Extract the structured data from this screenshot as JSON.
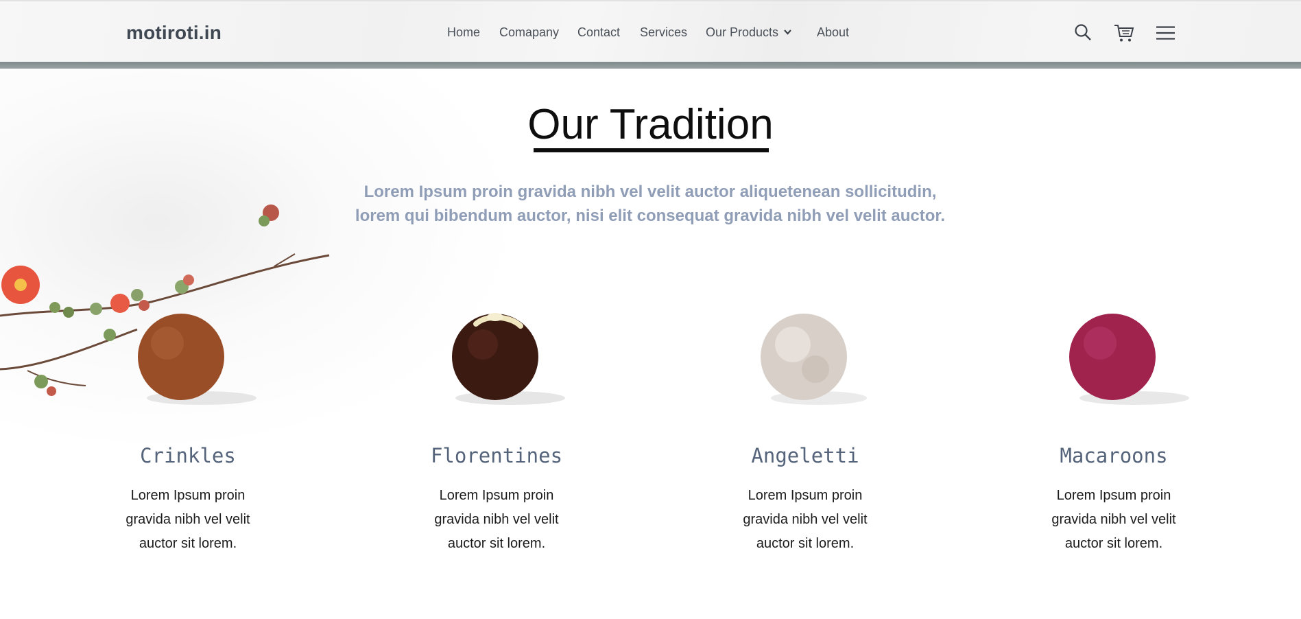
{
  "header": {
    "logo": "motiroti.in",
    "nav": [
      {
        "label": "Home"
      },
      {
        "label": "Comapany"
      },
      {
        "label": "Contact"
      },
      {
        "label": "Services"
      },
      {
        "label": "Our Products"
      },
      {
        "label": "About"
      }
    ],
    "icons": [
      "search-icon",
      "cart-icon",
      "menu-icon"
    ]
  },
  "section": {
    "title": "Our Tradition",
    "subtitle_line1": "Lorem Ipsum proin gravida nibh vel velit auctor aliquetenean sollicitudin,",
    "subtitle_line2": "lorem qui bibendum auctor, nisi elit consequat gravida nibh vel velit auctor."
  },
  "products": [
    {
      "name": "Crinkles",
      "desc": "Lorem Ipsum proin gravida nibh vel velit auctor sit lorem.",
      "color": "#9a4e27"
    },
    {
      "name": "Florentines",
      "desc": "Lorem Ipsum proin gravida nibh vel velit auctor sit lorem.",
      "color": "#3b1a12"
    },
    {
      "name": "Angeletti",
      "desc": "Lorem Ipsum proin gravida nibh vel velit auctor sit lorem.",
      "color": "#d8cfc8"
    },
    {
      "name": "Macaroons",
      "desc": "Lorem Ipsum proin gravida nibh vel velit auctor sit lorem.",
      "color": "#a0234e"
    }
  ],
  "colors": {
    "logo": "#3f4752",
    "header_bar": "#8a9596",
    "subtitle": "#8f9db6",
    "product_name": "#55647a"
  }
}
